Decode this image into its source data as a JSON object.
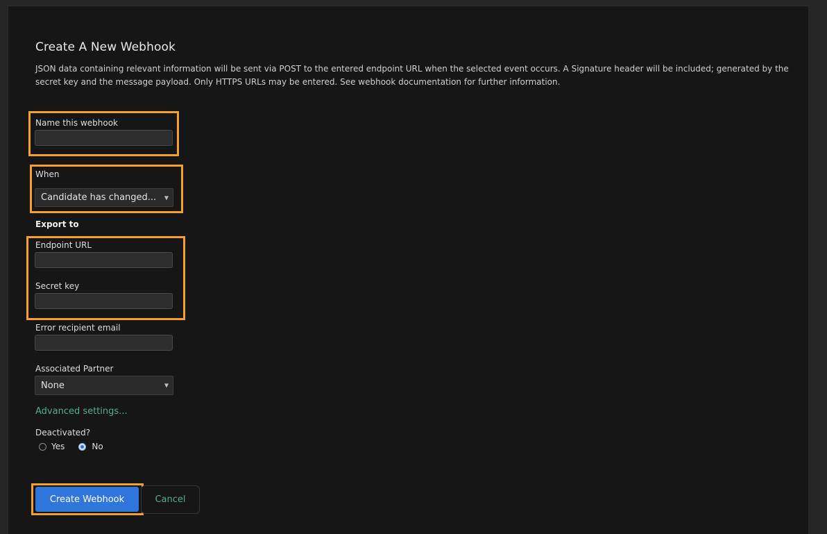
{
  "form": {
    "title": "Create A New Webhook",
    "description": "JSON data containing relevant information will be sent via POST to the entered endpoint URL when the selected event occurs. A Signature header will be included; generated by the secret key and the message payload. Only HTTPS URLs may be entered. See webhook documentation for further information.",
    "name_label": "Name this webhook",
    "name_value": "",
    "when_label": "When",
    "when_selected": "Candidate has changed...",
    "export_to_label": "Export to",
    "endpoint_label": "Endpoint URL",
    "endpoint_value": "",
    "secret_label": "Secret key",
    "secret_value": "",
    "error_email_label": "Error recipient email",
    "error_email_value": "",
    "partner_label": "Associated Partner",
    "partner_selected": "None",
    "advanced_link": "Advanced settings...",
    "deactivated_label": "Deactivated?",
    "deactivated_options": [
      "Yes",
      "No"
    ],
    "deactivated_selected": "No",
    "submit_label": "Create Webhook",
    "cancel_label": "Cancel"
  },
  "colors": {
    "highlight": "#f6a12e",
    "primary_button": "#2f76dc",
    "link": "#4fb08a",
    "panel_bg": "#161616"
  },
  "icons": {
    "select_caret": "caret-down-icon"
  }
}
